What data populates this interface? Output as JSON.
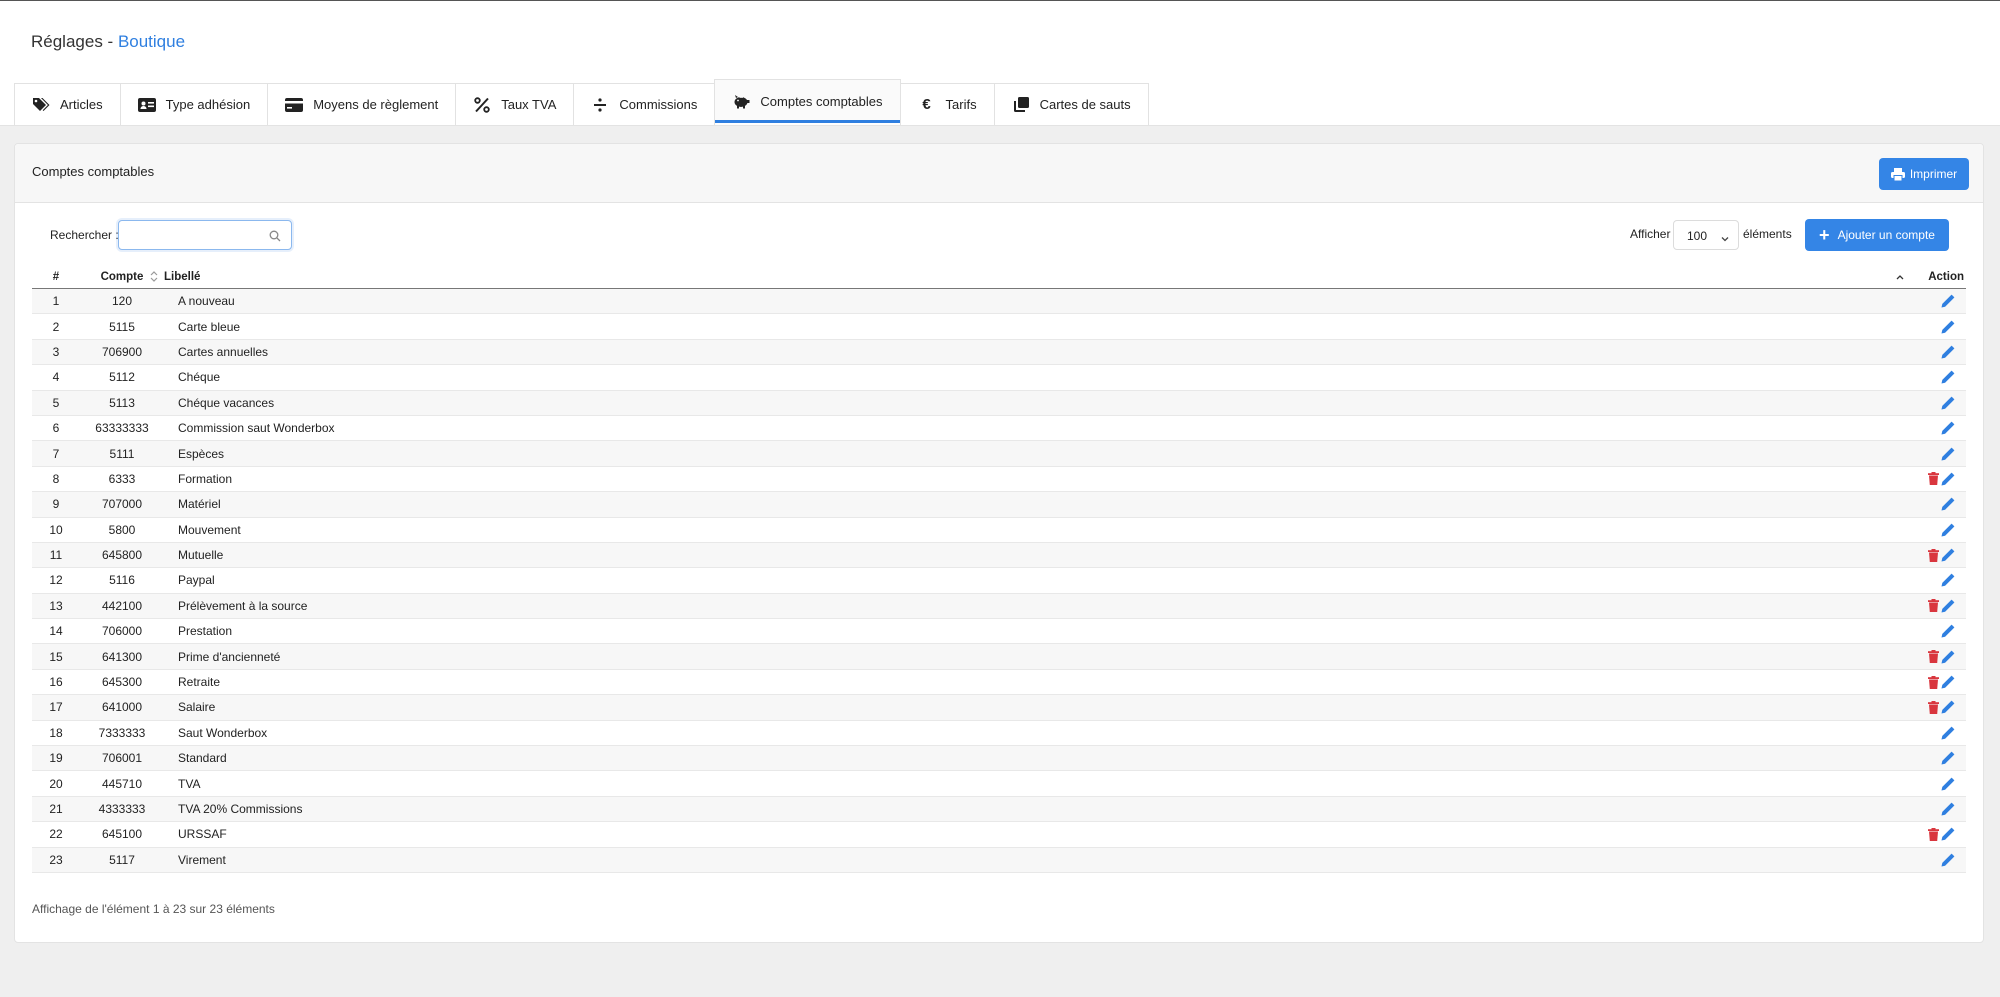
{
  "page": {
    "title_prefix": "Réglages",
    "title_sep": " - ",
    "title_accent": "Boutique"
  },
  "tabs": [
    {
      "label": "Articles",
      "icon": "tags-icon"
    },
    {
      "label": "Type adhésion",
      "icon": "id-card-icon"
    },
    {
      "label": "Moyens de règlement",
      "icon": "credit-card-icon"
    },
    {
      "label": "Taux TVA",
      "icon": "percent-icon"
    },
    {
      "label": "Commissions",
      "icon": "divide-icon"
    },
    {
      "label": "Comptes comptables",
      "icon": "piggy-bank-icon",
      "active": true
    },
    {
      "label": "Tarifs",
      "icon": "euro-icon"
    },
    {
      "label": "Cartes de sauts",
      "icon": "clone-icon"
    }
  ],
  "card": {
    "title": "Comptes comptables",
    "print_label": "Imprimer"
  },
  "controls": {
    "search_label": "Rechercher :",
    "search_value": "",
    "show_label": "Afficher",
    "page_size": "100",
    "show_after": "éléments",
    "add_label": "Ajouter un compte"
  },
  "table": {
    "headers": {
      "num": "#",
      "account": "Compte",
      "label": "Libellé",
      "action": "Action"
    },
    "rows": [
      {
        "num": "1",
        "account": "120",
        "label": "A nouveau",
        "delete": false
      },
      {
        "num": "2",
        "account": "5115",
        "label": "Carte bleue",
        "delete": false
      },
      {
        "num": "3",
        "account": "706900",
        "label": "Cartes annuelles",
        "delete": false
      },
      {
        "num": "4",
        "account": "5112",
        "label": "Chéque",
        "delete": false
      },
      {
        "num": "5",
        "account": "5113",
        "label": "Chéque vacances",
        "delete": false
      },
      {
        "num": "6",
        "account": "63333333",
        "label": "Commission saut Wonderbox",
        "delete": false
      },
      {
        "num": "7",
        "account": "5111",
        "label": "Espèces",
        "delete": false
      },
      {
        "num": "8",
        "account": "6333",
        "label": "Formation",
        "delete": true
      },
      {
        "num": "9",
        "account": "707000",
        "label": "Matériel",
        "delete": false
      },
      {
        "num": "10",
        "account": "5800",
        "label": "Mouvement",
        "delete": false
      },
      {
        "num": "11",
        "account": "645800",
        "label": "Mutuelle",
        "delete": true
      },
      {
        "num": "12",
        "account": "5116",
        "label": "Paypal",
        "delete": false
      },
      {
        "num": "13",
        "account": "442100",
        "label": "Prélèvement à la source",
        "delete": true
      },
      {
        "num": "14",
        "account": "706000",
        "label": "Prestation",
        "delete": false
      },
      {
        "num": "15",
        "account": "641300",
        "label": "Prime d'ancienneté",
        "delete": true
      },
      {
        "num": "16",
        "account": "645300",
        "label": "Retraite",
        "delete": true
      },
      {
        "num": "17",
        "account": "641000",
        "label": "Salaire",
        "delete": true
      },
      {
        "num": "18",
        "account": "7333333",
        "label": "Saut Wonderbox",
        "delete": false
      },
      {
        "num": "19",
        "account": "706001",
        "label": "Standard",
        "delete": false
      },
      {
        "num": "20",
        "account": "445710",
        "label": "TVA",
        "delete": false
      },
      {
        "num": "21",
        "account": "4333333",
        "label": "TVA 20% Commissions",
        "delete": false
      },
      {
        "num": "22",
        "account": "645100",
        "label": "URSSAF",
        "delete": true
      },
      {
        "num": "23",
        "account": "5117",
        "label": "Virement",
        "delete": false
      }
    ]
  },
  "footer": {
    "info": "Affichage de l'élément 1 à 23 sur 23 éléments"
  },
  "colors": {
    "accent": "#2f7fe0",
    "button": "#3485e6",
    "delete": "#d9363e",
    "edit": "#2f7fe0"
  }
}
